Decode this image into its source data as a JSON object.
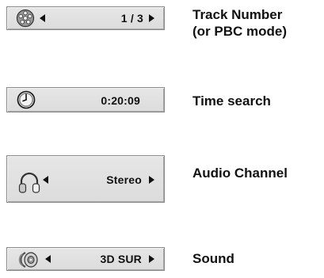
{
  "colors": {
    "box_bg": "#dcdcdc",
    "box_border": "#8a8a8a",
    "text": "#111111"
  },
  "rows": [
    {
      "icon": "disc-reel-icon",
      "value": "1 / 3",
      "label_lines": [
        "Track Number",
        "(or PBC mode)"
      ]
    },
    {
      "icon": "clock-icon",
      "value": "0:20:09",
      "label_lines": [
        "Time search"
      ]
    },
    {
      "icon": "headphones-icon",
      "value": "Stereo",
      "label_lines": [
        "Audio Channel"
      ]
    },
    {
      "icon": "speaker-3d-icon",
      "value": "3D SUR",
      "label_lines": [
        "Sound"
      ]
    }
  ]
}
